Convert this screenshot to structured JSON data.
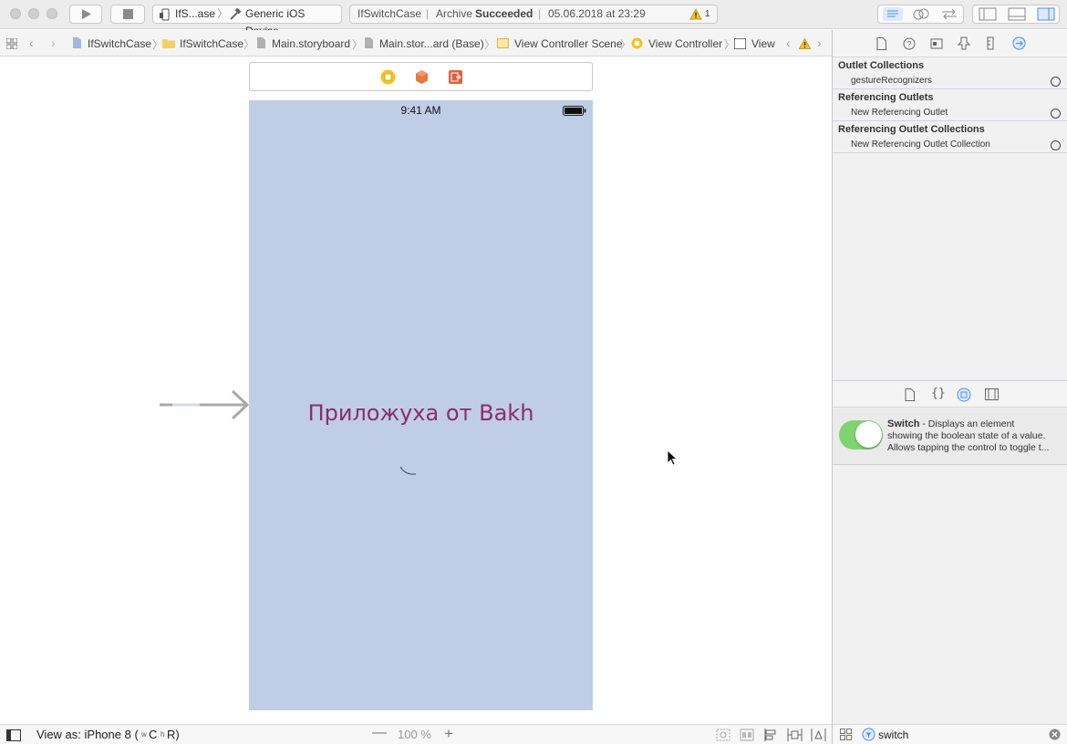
{
  "toolbar": {
    "scheme_name": "IfS...ase",
    "device_name": "Generic iOS Device",
    "activity": {
      "project": "IfSwitchCase",
      "action": "Archive",
      "status": "Succeeded",
      "datetime": "05.06.2018 at 23:29",
      "warning_count": "1"
    }
  },
  "jumpbar": {
    "crumbs": [
      "IfSwitchCase",
      "IfSwitchCase",
      "Main.storyboard",
      "Main.stor...ard (Base)",
      "View Controller Scene",
      "View Controller",
      "View"
    ]
  },
  "canvas": {
    "status_time": "9:41 AM",
    "title_label": "Приложуха от Bakh"
  },
  "inspector": {
    "sections": [
      {
        "title": "Outlet Collections",
        "item": "gestureRecognizers"
      },
      {
        "title": "Referencing Outlets",
        "item": "New Referencing Outlet"
      },
      {
        "title": "Referencing Outlet Collections",
        "item": "New Referencing Outlet Collection"
      }
    ]
  },
  "library": {
    "item_name": "Switch",
    "item_desc_line1": " - Displays an element",
    "item_desc_line2": "showing the boolean state of a value.",
    "item_desc_line3": "Allows tapping the control to toggle t...",
    "filter_value": "switch"
  },
  "bottombar": {
    "view_as": "View as: iPhone 8 (",
    "size_w": "w",
    "size_c": "C",
    "size_h": "h",
    "size_r": "R)",
    "zoom": "100 %"
  },
  "colors": {
    "phone_bg": "#bfcde6",
    "title_color": "#8b2e6b",
    "switch_on": "#7ed46e",
    "accent": "#4a8ff7"
  }
}
